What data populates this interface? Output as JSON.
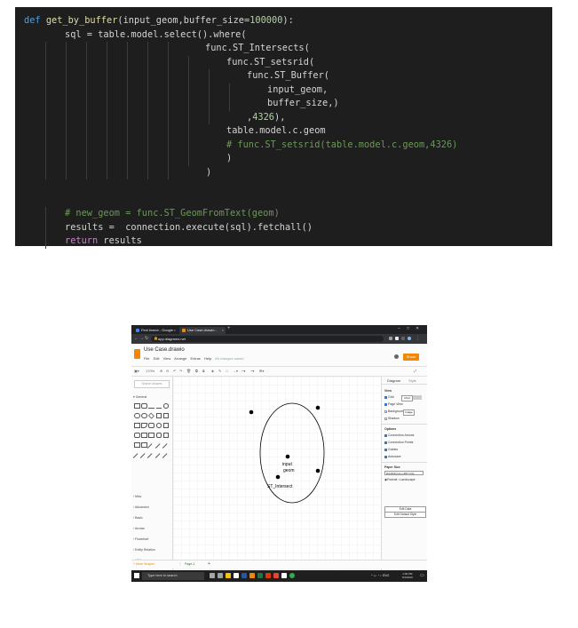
{
  "code": {
    "lines": [
      [
        [
          "kwb",
          "def "
        ],
        [
          "fn",
          "get_by_buffer"
        ],
        [
          "op",
          "(input_geom,buffer_size="
        ],
        [
          "num",
          "100000"
        ],
        [
          "op",
          "):"
        ]
      ],
      [
        [
          "op",
          "sql = table.model.select().where("
        ]
      ],
      [
        [
          "op",
          "func.ST_Intersects("
        ]
      ],
      [
        [
          "op",
          "func.ST_setsrid("
        ]
      ],
      [
        [
          "op",
          "func.ST_Buffer("
        ]
      ],
      [
        [
          "op",
          "input_geom,"
        ]
      ],
      [
        [
          "op",
          "buffer_size,)"
        ]
      ],
      [
        [
          "op",
          ","
        ],
        [
          "num",
          "4326"
        ],
        [
          "op",
          "),"
        ]
      ],
      [
        [
          "op",
          "table.model.c.geom"
        ]
      ],
      [
        [
          "cm",
          "# func.ST_setsrid(table.model.c.geom,4326)"
        ]
      ],
      [
        [
          "op",
          ")"
        ]
      ],
      [
        [
          "op",
          ")"
        ]
      ],
      [
        [
          "op",
          ""
        ]
      ],
      [
        [
          "op",
          ""
        ]
      ],
      [
        [
          "cm",
          "# new_geom = func.ST_GeomFromText(geom)"
        ]
      ],
      [
        [
          "op",
          "results =  connection.execute(sql).fetchall()"
        ]
      ],
      [
        [
          "kw",
          "return"
        ],
        [
          "op",
          " results"
        ]
      ]
    ]
  },
  "browser": {
    "tabs": [
      {
        "label": "Find Insect - Google search",
        "color": "#4285f4"
      },
      {
        "label": "Use Case.drawio - diagrams.net",
        "color": "#f08705"
      }
    ],
    "new_tab": "+",
    "url": "app.diagrams.net",
    "window_controls": [
      "–",
      "□",
      "✕"
    ]
  },
  "app": {
    "title": "Use Case.drawio",
    "menu": [
      "File",
      "Edit",
      "View",
      "Arrange",
      "Extras",
      "Help"
    ],
    "saved_status": "All changes saved",
    "share_label": "Share",
    "zoom": "170%",
    "search_placeholder": "Search shapes",
    "sections": [
      "General",
      "Misc",
      "Advanced",
      "Basic",
      "Arrows",
      "Flowchart",
      "Entity Relation",
      "UML"
    ],
    "more_shapes": "+ More Shapes"
  },
  "diagram": {
    "input_label_line1": "input",
    "input_label_line2": "geom",
    "intersect_label": "ST_Intersect"
  },
  "format_panel": {
    "tabs": [
      "Diagram",
      "Style"
    ],
    "view_label": "View",
    "grid_label": "Grid",
    "grid_size": "10 pt",
    "page_view_label": "Page View",
    "background_label": "Background",
    "image_button": "Image",
    "shadow_label": "Shadow",
    "options_label": "Options",
    "connection_arrows": "Connection Arrows",
    "connection_points": "Connection Points",
    "guides": "Guides",
    "autosave": "Autosave",
    "paper_size_label": "Paper Size",
    "paper_size_value": "A4 (210 mm x 297 mm)",
    "portrait": "Portrait",
    "landscape": "Landscape",
    "edit_data": "Edit Data",
    "edit_default_style": "Edit Default Style"
  },
  "pages": {
    "page_tab": "Page-1",
    "add_page": "+"
  },
  "taskbar": {
    "search_placeholder": "Type here to search",
    "lang": "ENG",
    "time": "1:09 PM",
    "date": "5/1/2020"
  }
}
